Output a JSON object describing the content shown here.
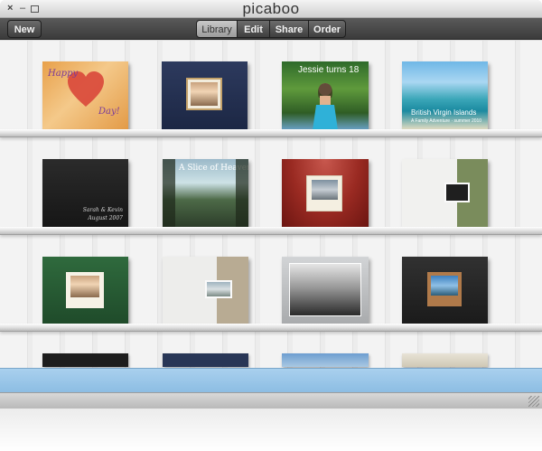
{
  "window": {
    "title": "picaboo",
    "controls": {
      "close": "×",
      "minimize": "–",
      "maximize": ""
    }
  },
  "toolbar": {
    "new_label": "New",
    "tabs": [
      {
        "label": "Library",
        "selected": true
      },
      {
        "label": "Edit",
        "selected": false
      },
      {
        "label": "Share",
        "selected": false
      },
      {
        "label": "Order",
        "selected": false
      }
    ]
  },
  "books": {
    "happy_day": {
      "line1": "Happy",
      "line2": "Day!"
    },
    "jessie": {
      "title": "Jessie turns 18"
    },
    "virgin_islands": {
      "title": "British Virgin Islands",
      "subtitle": "A Family Adventure · summer 2010"
    },
    "black_album": {
      "line1": "Sarah & Kevin",
      "line2": "August 2007"
    },
    "slice": {
      "title": "A Slice of Heaven"
    }
  },
  "colors": {
    "toolbar_dark": "#3b3b3b",
    "selected_tab": "#b8b8b8",
    "status_bar": "#9cc8ea"
  }
}
